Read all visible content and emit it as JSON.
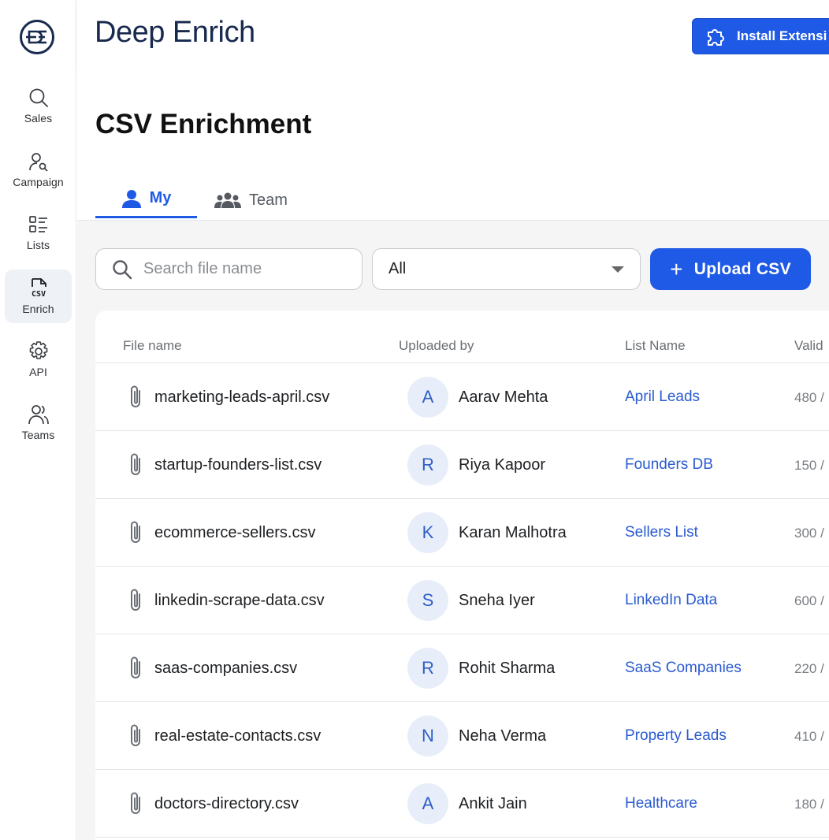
{
  "brand": {
    "name": "Deep Enrich"
  },
  "header": {
    "install_label": "Install Extensi"
  },
  "sidebar": {
    "items": [
      {
        "label": "Sales",
        "icon": "search-icon"
      },
      {
        "label": "Campaign",
        "icon": "user-search-icon"
      },
      {
        "label": "Lists",
        "icon": "list-icon"
      },
      {
        "label": "Enrich",
        "icon": "csv-file-icon"
      },
      {
        "label": "API",
        "icon": "gear-icon"
      },
      {
        "label": "Teams",
        "icon": "users-icon"
      }
    ],
    "active": "Enrich"
  },
  "page": {
    "title": "CSV Enrichment"
  },
  "tabs": [
    {
      "label": "My",
      "icon": "user-icon",
      "active": true
    },
    {
      "label": "Team",
      "icon": "group-icon",
      "active": false
    }
  ],
  "toolbar": {
    "search_placeholder": "Search file name",
    "filter_value": "All",
    "upload_label": "Upload CSV"
  },
  "table": {
    "columns": [
      "File name",
      "Uploaded by",
      "List Name",
      "Valid"
    ],
    "rows": [
      {
        "file": "marketing-leads-april.csv",
        "initial": "A",
        "user": "Aarav Mehta",
        "list": "April Leads",
        "valid": "480 /"
      },
      {
        "file": "startup-founders-list.csv",
        "initial": "R",
        "user": "Riya Kapoor",
        "list": "Founders DB",
        "valid": "150 /"
      },
      {
        "file": "ecommerce-sellers.csv",
        "initial": "K",
        "user": "Karan Malhotra",
        "list": "Sellers List",
        "valid": "300 /"
      },
      {
        "file": "linkedin-scrape-data.csv",
        "initial": "S",
        "user": "Sneha Iyer",
        "list": "LinkedIn Data",
        "valid": "600 /"
      },
      {
        "file": "saas-companies.csv",
        "initial": "R",
        "user": "Rohit Sharma",
        "list": "SaaS Companies",
        "valid": "220 /"
      },
      {
        "file": "real-estate-contacts.csv",
        "initial": "N",
        "user": "Neha Verma",
        "list": "Property Leads",
        "valid": "410 /"
      },
      {
        "file": "doctors-directory.csv",
        "initial": "A",
        "user": "Ankit Jain",
        "list": "Healthcare",
        "valid": "180 /"
      }
    ]
  },
  "colors": {
    "accent": "#1f5ae6",
    "brand_text": "#17294d",
    "link": "#2a5ad0"
  }
}
